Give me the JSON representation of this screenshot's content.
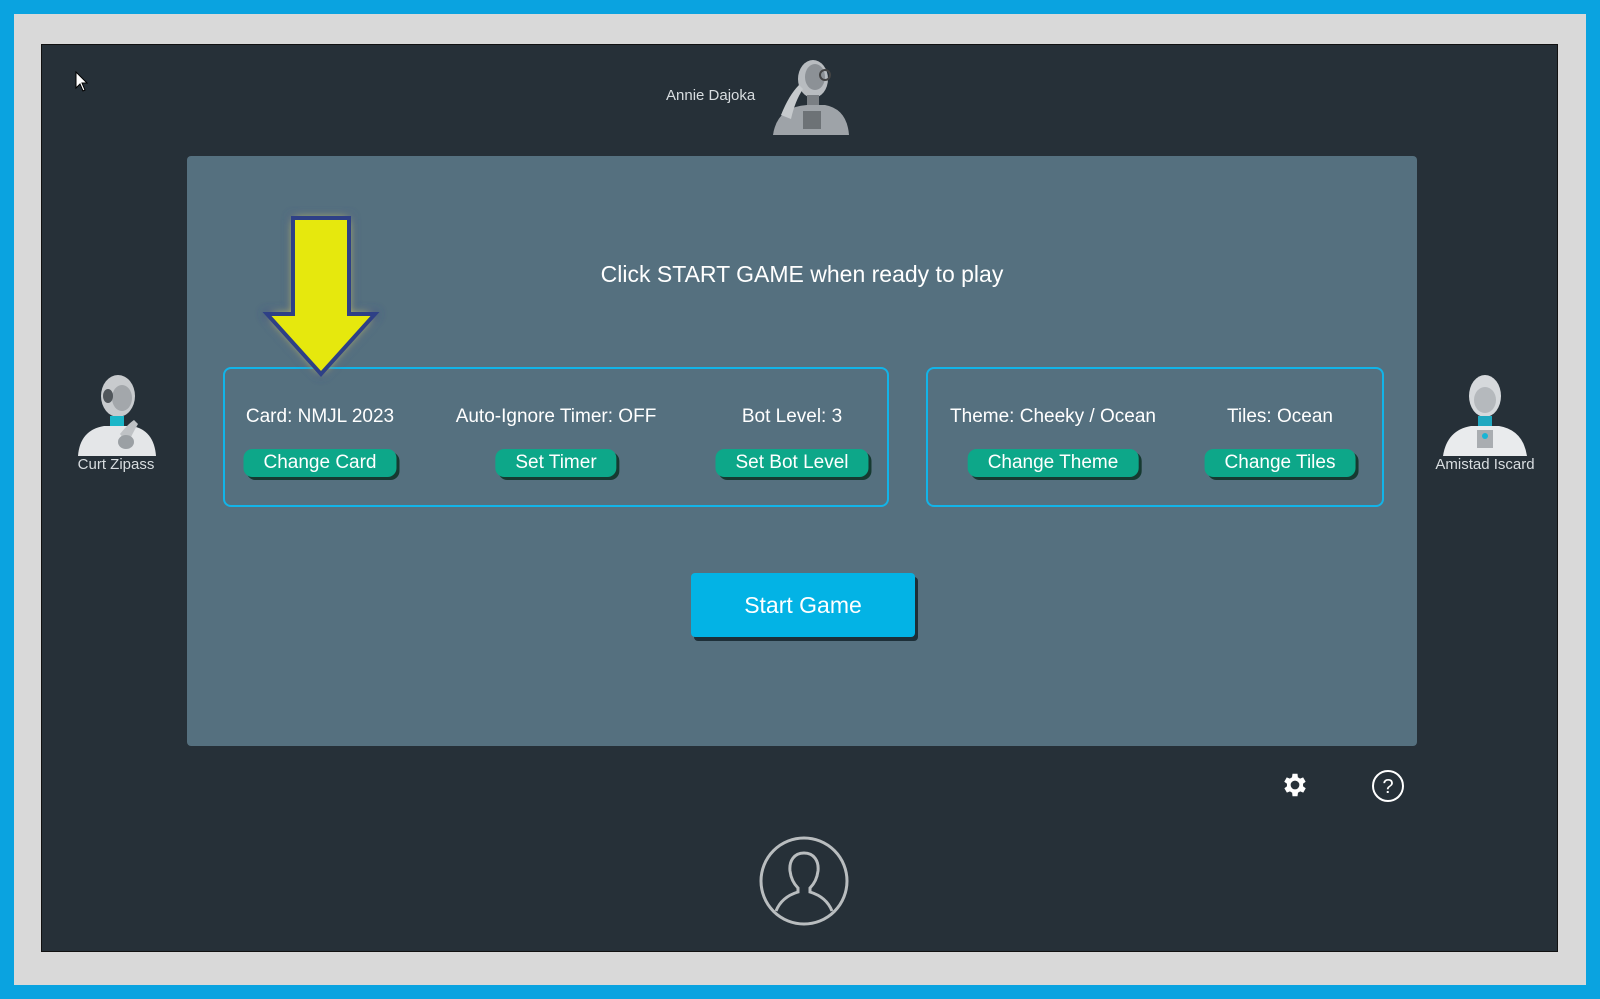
{
  "players": {
    "top": {
      "name": "Annie Dajoka",
      "avatar_icon": "robot-avatar-icon"
    },
    "left": {
      "name": "Curt Zipass",
      "avatar_icon": "robot-avatar-icon"
    },
    "right": {
      "name": "Amistad Iscard",
      "avatar_icon": "robot-avatar-icon"
    }
  },
  "panel": {
    "prompt": "Click START GAME when ready to play",
    "settings_left": {
      "card_label": "Card: NMJL 2023",
      "card_button": "Change Card",
      "timer_label": "Auto-Ignore Timer: OFF",
      "timer_button": "Set Timer",
      "bot_label": "Bot Level: 3",
      "bot_button": "Set Bot Level"
    },
    "settings_right": {
      "theme_label": "Theme: Cheeky / Ocean",
      "theme_button": "Change Theme",
      "tiles_label": "Tiles: Ocean",
      "tiles_button": "Change Tiles"
    },
    "start_button": "Start Game"
  },
  "footer": {
    "settings_icon": "gear-icon",
    "help_icon": "help-icon",
    "user_icon": "user-avatar-icon"
  },
  "colors": {
    "background": "#263038",
    "panel": "#55707f",
    "accent_green": "#0da789",
    "accent_blue": "#03b3e5",
    "highlight_arrow": "#e6e80b"
  }
}
